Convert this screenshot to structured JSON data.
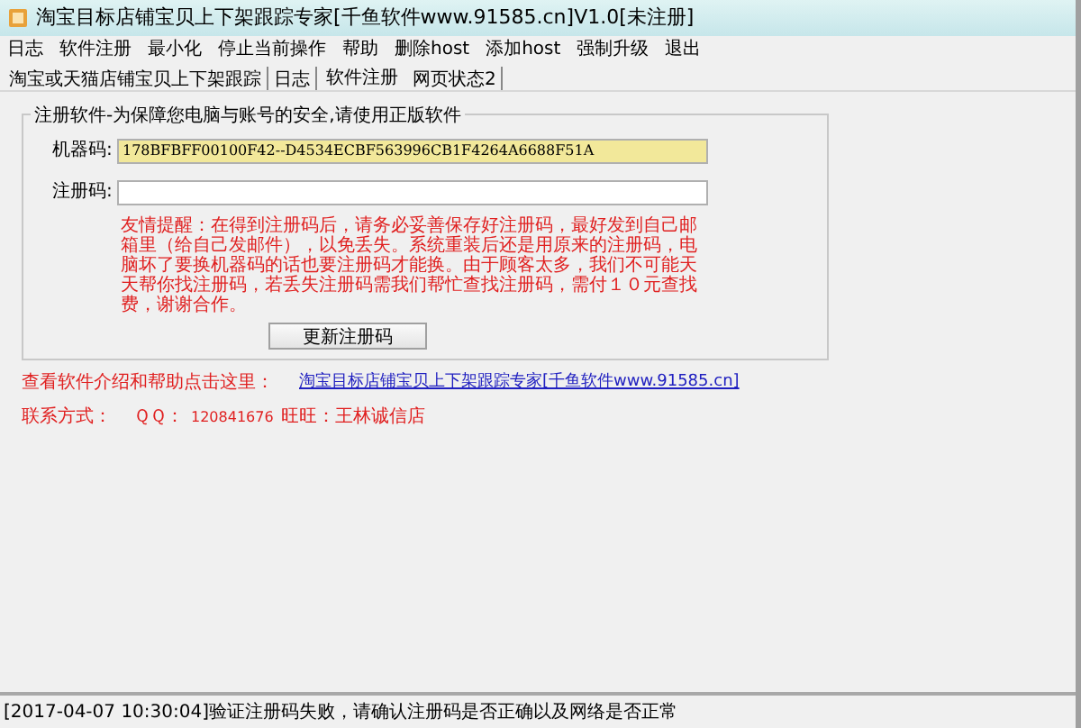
{
  "window": {
    "title": "淘宝目标店铺宝贝上下架跟踪专家[千鱼软件www.91585.cn]V1.0[未注册]"
  },
  "menu": [
    "日志",
    "软件注册",
    "最小化",
    "停止当前操作",
    "帮助",
    "删除host",
    "添加host",
    "强制升级",
    "退出"
  ],
  "tabs": [
    {
      "label": "淘宝或天猫店铺宝贝上下架跟踪",
      "selected": false
    },
    {
      "label": "日志",
      "selected": false
    },
    {
      "label": "软件注册",
      "selected": true
    },
    {
      "label": "网页状态2",
      "selected": false
    }
  ],
  "register_group": {
    "title": "注册软件-为保障您电脑与账号的安全,请使用正版软件",
    "machine_code": {
      "label": "机器码:",
      "value": "178BFBFF00100F42--D4534ECBF563996CB1F4264A6688F51A"
    },
    "register_code": {
      "label": "注册码:"
    },
    "notice": "友情提醒：在得到注册码后，请务必妥善保存好注册码，最好发到自己邮箱里（给自己发邮件），以免丢失。系统重装后还是用原来的注册码，电脑坏了要换机器码的话也要注册码才能换。由于顾客太多，我们不可能天天帮你找注册码，若丢失注册码需我们帮忙查找注册码，需付１０元查找费，谢谢合作。",
    "button": "更新注册码"
  },
  "help": {
    "label": "查看软件介绍和帮助点击这里：",
    "link": "淘宝目标店铺宝贝上下架跟踪专家[千鱼软件www.91585.cn]"
  },
  "contact": {
    "label": "联系方式：",
    "qq_label": "ＱＱ：",
    "qq": "120841676",
    "wangwang": "旺旺：王林诚信店"
  },
  "status_bar": "[2017-04-07 10:30:04]验证注册码失败，请确认注册码是否正确以及网络是否正常"
}
